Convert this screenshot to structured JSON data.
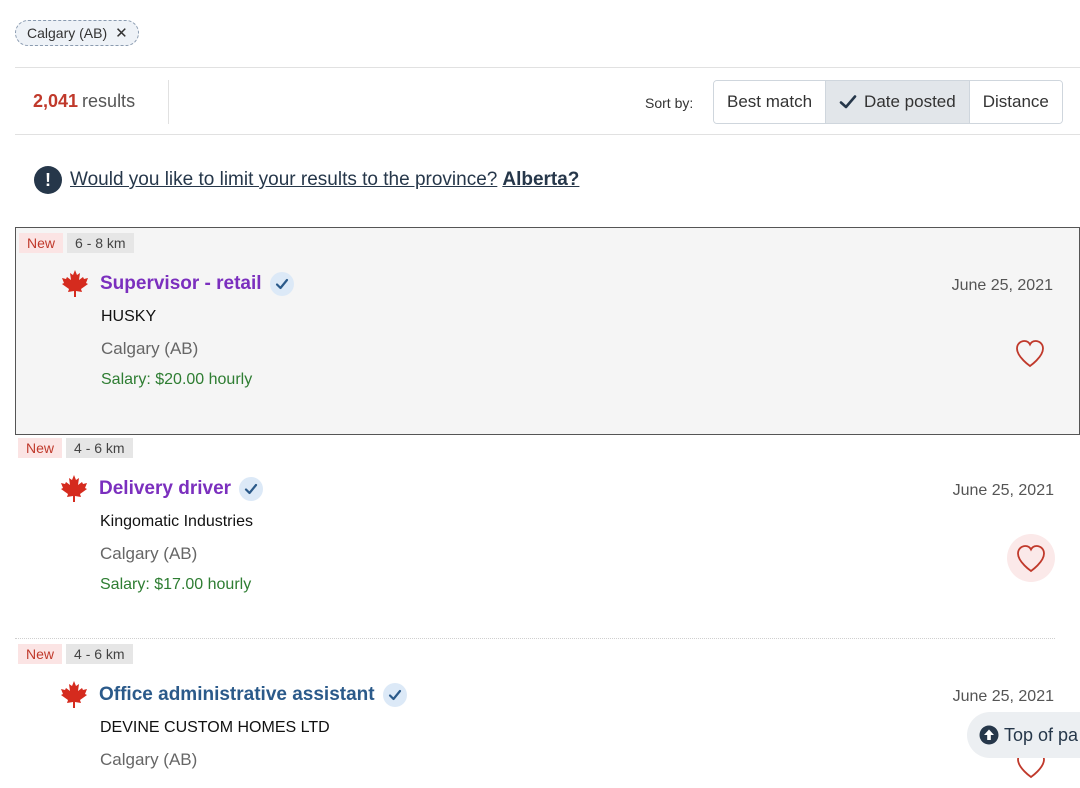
{
  "filter": {
    "label": "Calgary (AB)",
    "remove": "✕"
  },
  "results": {
    "count": "2,041",
    "label": "results"
  },
  "sort": {
    "label": "Sort by:",
    "options": [
      {
        "label": "Best match",
        "active": false
      },
      {
        "label": "Date posted",
        "active": true
      },
      {
        "label": "Distance",
        "active": false
      }
    ]
  },
  "notice": {
    "question": "Would you like to limit your results to the province?",
    "province": "Alberta?"
  },
  "jobs": [
    {
      "new": "New",
      "distance": "6 - 8 km",
      "title": "Supervisor - retail",
      "company": "HUSKY",
      "location": "Calgary (AB)",
      "salary": "Salary: $20.00 hourly",
      "date": "June 25, 2021"
    },
    {
      "new": "New",
      "distance": "4 - 6 km",
      "title": "Delivery driver",
      "company": "Kingomatic Industries",
      "location": "Calgary (AB)",
      "salary": "Salary: $17.00 hourly",
      "date": "June 25, 2021"
    },
    {
      "new": "New",
      "distance": "4 - 6 km",
      "title": "Office administrative assistant",
      "company": "DEVINE CUSTOM HOMES LTD",
      "location": "Calgary (AB)",
      "salary": "",
      "date": "June 25, 2021"
    }
  ],
  "top_button": {
    "label": "Top of pa"
  },
  "colors": {
    "new_tag": "#c0392b",
    "title_visited": "#7b2fbe",
    "title_link": "#2b5a8a",
    "salary": "#2e7d32",
    "heart": "#c0392b"
  },
  "icons": {
    "leaf": "maple-leaf-icon",
    "verified": "verified-check-icon",
    "favourite": "heart-icon",
    "info": "exclamation-icon",
    "top": "arrow-up-circle-icon"
  }
}
